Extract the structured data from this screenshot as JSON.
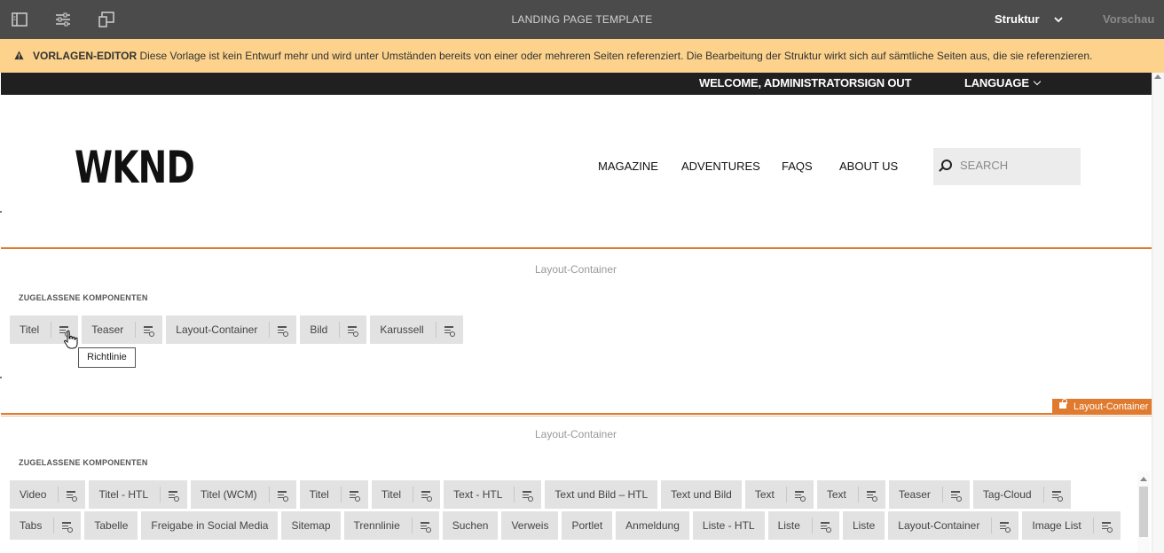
{
  "toolbar": {
    "title": "LANDING PAGE TEMPLATE",
    "mode_label": "Struktur",
    "preview_label": "Vorschau",
    "icons": [
      "side-panel-icon",
      "page-properties-icon",
      "emulator-icon",
      "chevron-down-icon"
    ]
  },
  "banner": {
    "heading": "VORLAGEN-EDITOR",
    "message": "Diese Vorlage ist kein Entwurf mehr und wird unter Umständen bereits von einer oder mehreren Seiten referenziert. Die Bearbeitung der Struktur wirkt sich auf sämtliche Seiten aus, die sie referenzieren."
  },
  "site": {
    "welcome": "WELCOME, ADMINISTRATOR",
    "sign_out": "SIGN OUT",
    "language": "LANGUAGE",
    "logo": "WKND",
    "nav": [
      "MAGAZINE",
      "ADVENTURES",
      "FAQS",
      "ABOUT US"
    ],
    "search_placeholder": "SEARCH"
  },
  "containers": [
    {
      "title": "Layout-Container",
      "allowed_label": "ZUGELASSENE KOMPONENTEN",
      "components": [
        {
          "label": "Titel",
          "policy": true
        },
        {
          "label": "Teaser",
          "policy": true
        },
        {
          "label": "Layout-Container",
          "policy": true
        },
        {
          "label": "Bild",
          "policy": true
        },
        {
          "label": "Karussell",
          "policy": true
        }
      ]
    },
    {
      "title": "Layout-Container",
      "allowed_label": "ZUGELASSENE KOMPONENTEN",
      "components_row1": [
        {
          "label": "Video",
          "policy": true
        },
        {
          "label": "Titel - HTL",
          "policy": true
        },
        {
          "label": "Titel (WCM)",
          "policy": true
        },
        {
          "label": "Titel",
          "policy": true
        },
        {
          "label": "Titel",
          "policy": true
        },
        {
          "label": "Text - HTL",
          "policy": true
        },
        {
          "label": "Text und Bild – HTL",
          "policy": false
        },
        {
          "label": "Text und Bild",
          "policy": false
        },
        {
          "label": "Text",
          "policy": true
        },
        {
          "label": "Text",
          "policy": true
        },
        {
          "label": "Teaser",
          "policy": true
        },
        {
          "label": "Tag-Cloud",
          "policy": true
        }
      ],
      "components_row2": [
        {
          "label": "Tabs",
          "policy": true
        },
        {
          "label": "Tabelle",
          "policy": false
        },
        {
          "label": "Freigabe in Social Media",
          "policy": false
        },
        {
          "label": "Sitemap",
          "policy": false
        },
        {
          "label": "Trennlinie",
          "policy": true
        },
        {
          "label": "Suchen",
          "policy": false
        },
        {
          "label": "Verweis",
          "policy": false
        },
        {
          "label": "Portlet",
          "policy": false
        },
        {
          "label": "Anmeldung",
          "policy": false
        },
        {
          "label": "Liste - HTL",
          "policy": false
        },
        {
          "label": "Liste",
          "policy": true
        },
        {
          "label": "Liste",
          "policy": false
        },
        {
          "label": "Layout-Container",
          "policy": true
        },
        {
          "label": "Image List",
          "policy": true
        }
      ]
    }
  ],
  "tooltip": "Richtlinie",
  "container_tag": "Layout-Container",
  "colors": {
    "toolbar": "#4b4b4b",
    "banner": "#fcd28c",
    "accent": "#e07a2e",
    "chip": "#e2e2e2"
  }
}
